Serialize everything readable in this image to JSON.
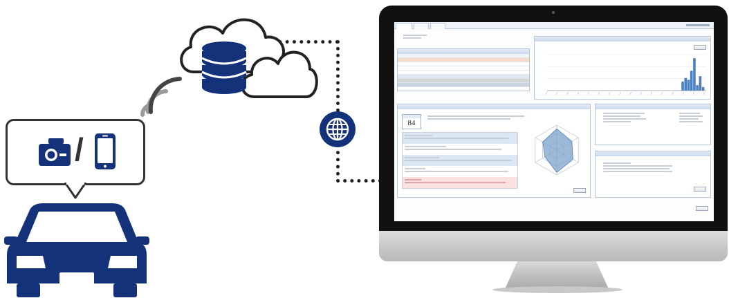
{
  "bubble": {
    "separator": "/"
  },
  "dashboard": {
    "tabs": [],
    "score": "84",
    "list_rows": 8,
    "bar_values": [
      0,
      0,
      0,
      0,
      0,
      0,
      0,
      0,
      0,
      0,
      0,
      0,
      0,
      0,
      0,
      0,
      0,
      0,
      0,
      0,
      0,
      0,
      0,
      0,
      0,
      0,
      0,
      0,
      0,
      0,
      0,
      0,
      0,
      0,
      0,
      0,
      0,
      0,
      0,
      0,
      0,
      0,
      0,
      0,
      0,
      0,
      0.25,
      0.35,
      0.3,
      0.55,
      0.9,
      0.15,
      0.4,
      0.1
    ],
    "radar_values": [
      0.85,
      0.7,
      0.75,
      0.9,
      0.55,
      0.65
    ]
  },
  "colors": {
    "brand_navy": "#14327a",
    "cloud_outline": "#222222",
    "signal_gray": "#9a9a9a",
    "signal_dark": "#444444",
    "screen_accent": "#4b7fc0"
  },
  "icons": [
    "cloud-icon",
    "database-icon",
    "wifi-signal-icon",
    "globe-icon",
    "dashcam-icon",
    "smartphone-icon",
    "car-icon",
    "monitor-icon"
  ]
}
